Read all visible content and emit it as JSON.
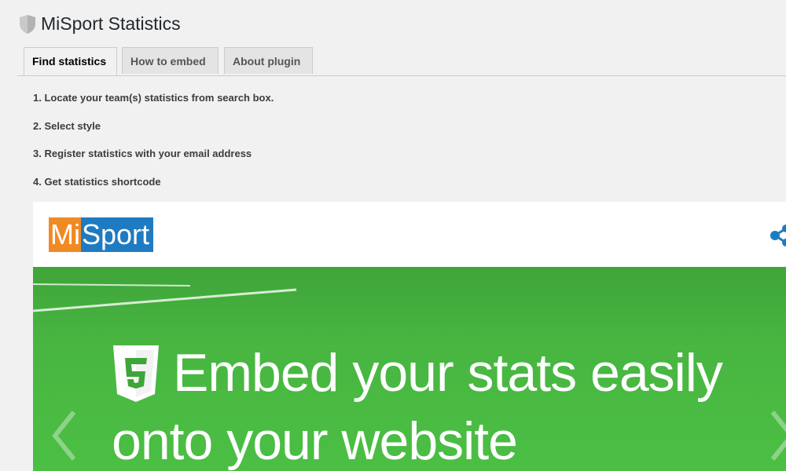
{
  "header": {
    "title": "MiSport Statistics",
    "icon": "shield-icon"
  },
  "tabs": [
    {
      "label": "Find statistics",
      "active": true
    },
    {
      "label": "How to embed",
      "active": false
    },
    {
      "label": "About plugin",
      "active": false
    }
  ],
  "steps": [
    "1. Locate your team(s) statistics from search box.",
    "2. Select style",
    "3. Register statistics with your email address",
    "4. Get statistics shortcode"
  ],
  "widget": {
    "logo_mi": "Mi",
    "logo_sport": "Sport",
    "hero_line_1": "Embed your stats easily",
    "hero_line_2": "onto your website",
    "colors": {
      "logo_orange": "#f08a24",
      "logo_blue": "#1f7bc1",
      "field_green": "#48b641",
      "share_blue": "#1f7bc1"
    }
  }
}
